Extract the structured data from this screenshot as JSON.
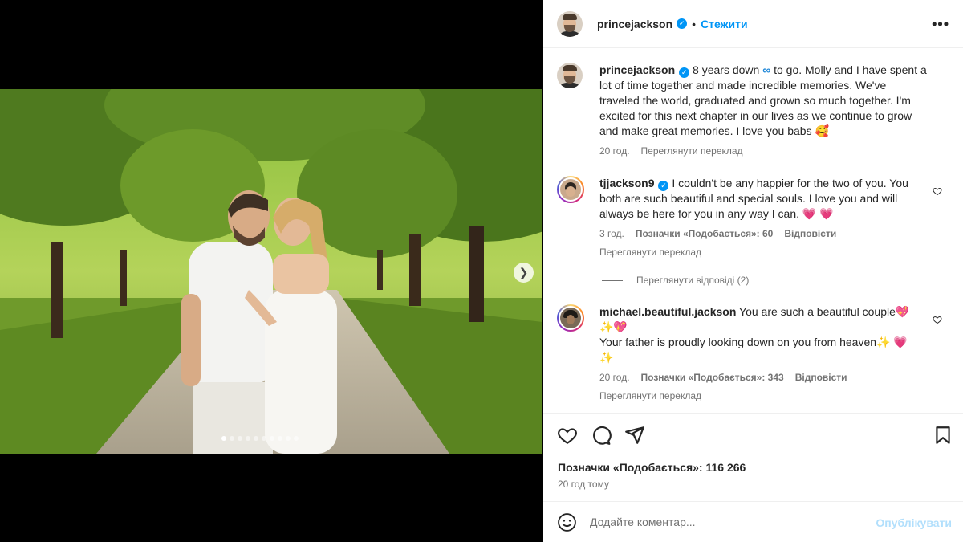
{
  "post": {
    "author": "princejackson",
    "follow_label": "Стежити",
    "dot": "•",
    "more_icon": "more-horizontal-icon",
    "carousel": {
      "total": 10,
      "active": 1
    }
  },
  "caption": {
    "username": "princejackson",
    "text_a": "8 years down ",
    "infinity": "∞",
    "text_b": " to go. Molly and I have spent a lot of time together and made incredible memories. We've traveled the world, graduated and grown so much together. I'm excited for this next chapter in our lives as we continue to grow and make great memories. I love you babs ",
    "emoji": "🥰",
    "time": "20 год.",
    "translate": "Переглянути переклад"
  },
  "comments": [
    {
      "username": "tjjackson9",
      "text": " I couldn't be any happier for the two of you. You both are such beautiful and special souls. I love you and will always be here for you in any way I can. ",
      "emojis": "💗 💗",
      "time": "3 год.",
      "likes": "Позначки «Подобається»: 60",
      "reply": "Відповісти",
      "translate": "Переглянути переклад",
      "view_replies": "Переглянути відповіді (2)"
    },
    {
      "username": "michael.beautiful.jackson",
      "text": " You are such a beautiful couple",
      "emojis_a": "💖",
      "emojis_b": "✨💖",
      "text2": "Your father is proudly looking down on you from heaven",
      "emojis_c": "✨ 💗",
      "emojis_d": "✨",
      "time": "20 год.",
      "likes": "Позначки «Подобається»: 343",
      "reply": "Відповісти",
      "translate": "Переглянути переклад"
    }
  ],
  "actions": {
    "likes": "Позначки «Подобається»: 116 266",
    "time_ago": "20 год тому"
  },
  "composer": {
    "placeholder": "Додайте коментар...",
    "publish": "Опублікувати"
  }
}
